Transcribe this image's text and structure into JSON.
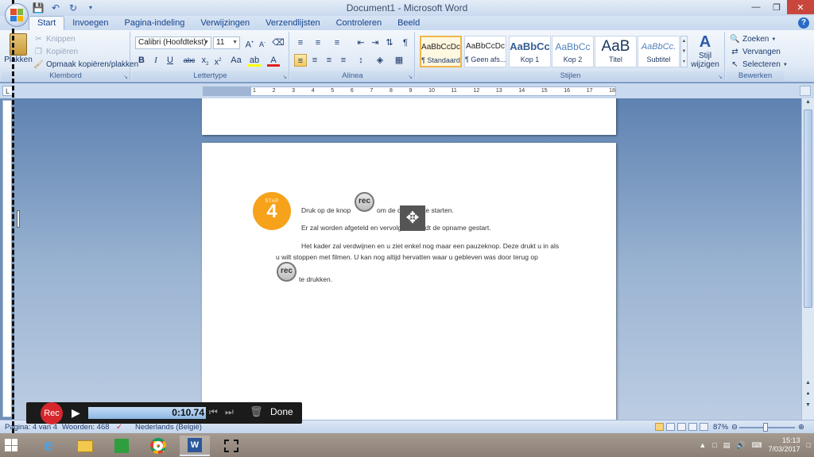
{
  "window": {
    "title": "Document1 - Microsoft Word",
    "controls": [
      "minimize",
      "restore",
      "close"
    ]
  },
  "ribbon_tabs": [
    {
      "label": "Start",
      "active": true
    },
    {
      "label": "Invoegen"
    },
    {
      "label": "Pagina-indeling"
    },
    {
      "label": "Verwijzingen"
    },
    {
      "label": "Verzendlijsten"
    },
    {
      "label": "Controleren"
    },
    {
      "label": "Beeld"
    }
  ],
  "clipboard": {
    "group_label": "Klembord",
    "paste_label": "Plakken",
    "cut_label": "Knippen",
    "copy_label": "Kopiëren",
    "format_painter_label": "Opmaak kopiëren/plakken"
  },
  "font": {
    "group_label": "Lettertype",
    "font_name": "Calibri (Hoofdtekst)",
    "font_size": "11"
  },
  "paragraph": {
    "group_label": "Alinea"
  },
  "styles": {
    "group_label": "Stijlen",
    "items": [
      {
        "sample": "AaBbCcDc",
        "name": "¶ Standaard",
        "selected": true
      },
      {
        "sample": "AaBbCcDc",
        "name": "¶ Geen afs..."
      },
      {
        "sample": "AaBbCc",
        "name": "Kop 1"
      },
      {
        "sample": "AaBbCc",
        "name": "Kop 2"
      },
      {
        "sample": "AaB",
        "name": "Titel"
      },
      {
        "sample": "AaBbCc.",
        "name": "Subtitel"
      }
    ],
    "change_styles_label_1": "Stijl",
    "change_styles_label_2": "wijzigen"
  },
  "editing": {
    "group_label": "Bewerken",
    "find_label": "Zoeken",
    "replace_label": "Vervangen",
    "select_label": "Selecteren"
  },
  "ruler": {
    "ticks": [
      "1",
      "2",
      "3",
      "4",
      "5",
      "6",
      "7",
      "8",
      "9",
      "10",
      "11",
      "12",
      "13",
      "14",
      "15",
      "16",
      "17",
      "18"
    ]
  },
  "document": {
    "step_label": "STAP",
    "step_number": "4",
    "line1_before": "Druk op de knop",
    "line1_after": "om de opname te starten.",
    "line2": "Er zal worden afgeteld en vervolgens wordt de opname gestart.",
    "line3": "Het kader zal verdwijnen en u ziet enkel nog maar een pauzeknop. Deze drukt u in als",
    "line4": "u wilt stoppen met filmen. U kan nog altijd hervatten waar u gebleven was door terug op",
    "line5": "te drukken.",
    "rec_icon_text": "rec"
  },
  "statusbar": {
    "page": "Pagina: 4 van 4",
    "words": "Woorden: 468",
    "language": "Nederlands (België)",
    "zoom": "87%"
  },
  "recorder": {
    "rec_label": "Rec",
    "time": "0:10.74",
    "done_label": "Done",
    "progress": 1.0
  },
  "taskbar": {
    "time": "15:13",
    "date": "7/03/2017"
  },
  "colors": {
    "step_badge": "#f7a21b",
    "rec_button": "#d7262b",
    "ribbon_text": "#15428b"
  }
}
